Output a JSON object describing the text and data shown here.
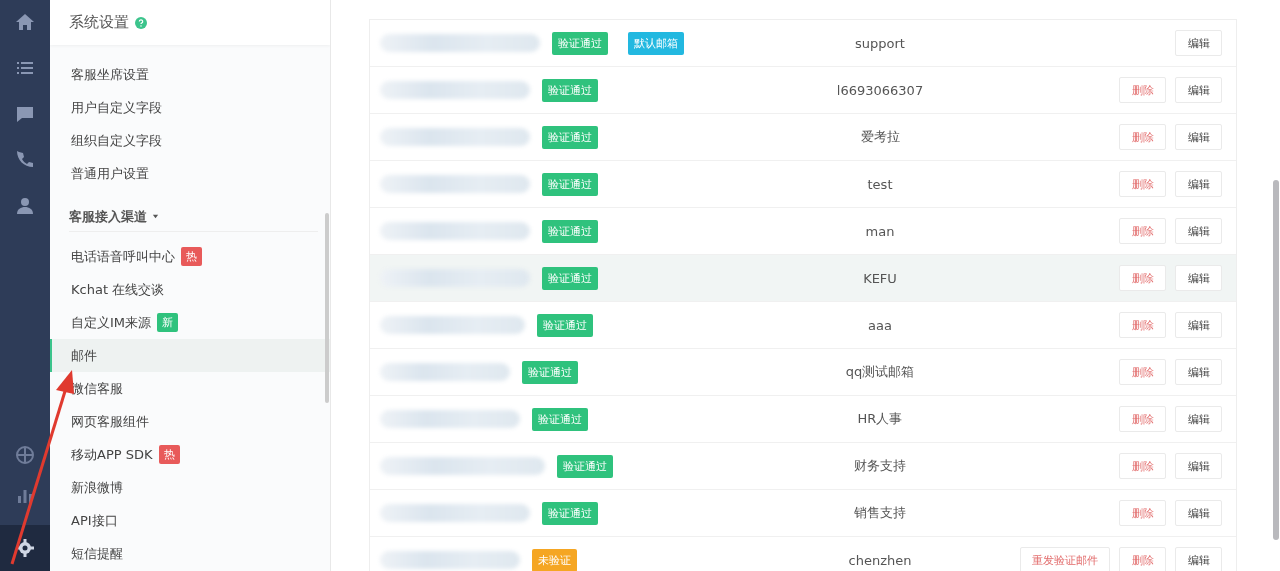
{
  "rail": {
    "icons": [
      {
        "kind": "home"
      },
      {
        "kind": "list"
      },
      {
        "kind": "chat"
      },
      {
        "kind": "phone"
      },
      {
        "kind": "user"
      }
    ],
    "bottom_icons": [
      {
        "kind": "globe"
      },
      {
        "kind": "chart"
      },
      {
        "kind": "gear"
      }
    ]
  },
  "sidebar": {
    "title": "系统设置",
    "groups": [
      {
        "items": [
          {
            "label": "客服坐席设置",
            "selected": false
          },
          {
            "label": "用户自定义字段",
            "selected": false
          },
          {
            "label": "组织自定义字段",
            "selected": false
          },
          {
            "label": "普通用户设置",
            "selected": false
          }
        ]
      },
      {
        "heading": "客服接入渠道",
        "expanded": true,
        "items": [
          {
            "label": "电话语音呼叫中心",
            "badge": "热",
            "kind": "hot",
            "selected": false
          },
          {
            "label": "Kchat 在线交谈",
            "selected": false
          },
          {
            "label": "自定义IM来源",
            "badge": "新",
            "kind": "new",
            "selected": false
          },
          {
            "label": "邮件",
            "selected": true
          },
          {
            "label": "微信客服",
            "selected": false
          },
          {
            "label": "网页客服组件",
            "selected": false
          },
          {
            "label": "移动APP SDK",
            "badge": "热",
            "kind": "hot",
            "selected": false
          },
          {
            "label": "新浪微博",
            "selected": false
          },
          {
            "label": "API接口",
            "selected": false
          },
          {
            "label": "短信提醒",
            "selected": false
          }
        ]
      }
    ]
  },
  "table": {
    "rows": [
      {
        "status": "验证通过",
        "kind": "verified",
        "default_tag": "默认邮箱",
        "name": "support",
        "edit": "编辑",
        "highlighted": false
      },
      {
        "status": "验证通过",
        "kind": "verified",
        "name": "l6693066307",
        "delete": "删除",
        "edit": "编辑",
        "highlighted": false
      },
      {
        "status": "验证通过",
        "kind": "verified",
        "name": "爱考拉",
        "delete": "删除",
        "edit": "编辑",
        "highlighted": false
      },
      {
        "status": "验证通过",
        "kind": "verified",
        "name": "test",
        "delete": "删除",
        "edit": "编辑",
        "highlighted": false
      },
      {
        "status": "验证通过",
        "kind": "verified",
        "name": "man",
        "delete": "删除",
        "edit": "编辑",
        "highlighted": false
      },
      {
        "status": "验证通过",
        "kind": "verified",
        "name": "KEFU",
        "delete": "删除",
        "edit": "编辑",
        "highlighted": true
      },
      {
        "status": "验证通过",
        "kind": "verified",
        "name": "aaa",
        "delete": "删除",
        "edit": "编辑",
        "highlighted": false
      },
      {
        "status": "验证通过",
        "kind": "verified",
        "name": "qq测试邮箱",
        "delete": "删除",
        "edit": "编辑",
        "highlighted": false
      },
      {
        "status": "验证通过",
        "kind": "verified",
        "name": "HR人事",
        "delete": "删除",
        "edit": "编辑",
        "highlighted": false
      },
      {
        "status": "验证通过",
        "kind": "verified",
        "name": "财务支持",
        "delete": "删除",
        "edit": "编辑",
        "highlighted": false
      },
      {
        "status": "验证通过",
        "kind": "verified",
        "name": "销售支持",
        "delete": "删除",
        "edit": "编辑",
        "highlighted": false
      },
      {
        "status": "未验证",
        "kind": "unverified",
        "resend": "重发验证邮件",
        "name": "chenzhen",
        "delete": "删除",
        "edit": "编辑",
        "highlighted": false
      }
    ]
  }
}
